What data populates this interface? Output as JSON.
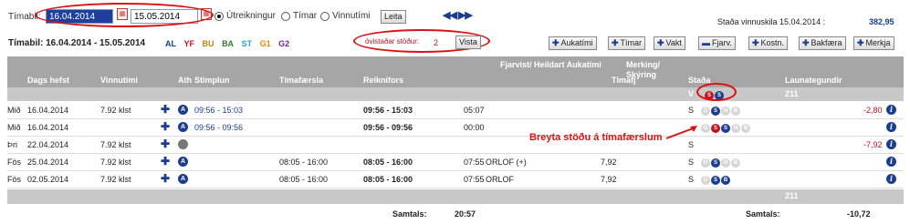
{
  "top": {
    "period_label": "Tímabil:",
    "date_from": "16.04.2014",
    "date_to": "15.05.2014",
    "radio_options": [
      "Útreikningur",
      "Tímar",
      "Vinnutími"
    ],
    "search_button": "Leita",
    "status_label": "Staða vinnuskila 15.04.2014 :",
    "status_value": "382,95"
  },
  "second": {
    "period_text": "Tímabil: 16.04.2014 - 15.05.2014",
    "categories": [
      {
        "label": "AL",
        "color": "#1a3d8f"
      },
      {
        "label": "YF",
        "color": "#c1121f"
      },
      {
        "label": "BU",
        "color": "#b8860b"
      },
      {
        "label": "BA",
        "color": "#2e7d32"
      },
      {
        "label": "ST",
        "color": "#29a3c9"
      },
      {
        "label": "G1",
        "color": "#e08a00"
      },
      {
        "label": "G2",
        "color": "#6a2a8f"
      }
    ],
    "unconfirmed_label": "óvistaðar stöður:",
    "unconfirmed_count": "2",
    "save_button": "Vista",
    "actions": [
      "Aukatími",
      "Tímar",
      "Vakt",
      "Fjarv.",
      "Kostn.",
      "Bakfæra",
      "Merkja"
    ]
  },
  "table": {
    "headers": [
      "",
      "Dags hefst",
      "Vinnutími",
      "Ath",
      "Stimplun",
      "Tímafærsla",
      "Reiknifors",
      "Fjarvist/ Heildart Aukatími",
      "Tímafj",
      "Merking/ Skýring",
      "Staða",
      "Launategundir",
      ""
    ],
    "sub_staða_label": "V",
    "sub_launategundir": "211",
    "rows": [
      {
        "day": "Mið",
        "date": "16.04.2014",
        "vinnutimi": "7.92 klst",
        "icon": "blue",
        "stimplun": "09:56 - 15:03",
        "timafaersla": "",
        "reiknifors": "09:56 - 15:03",
        "heildart": "05:07",
        "aukatimi": "",
        "timafj": "",
        "status": "S",
        "status_icons": [
          "g",
          "b",
          "g",
          "g"
        ],
        "launa": "-2,80"
      },
      {
        "day": "Mið",
        "date": "16.04.2014",
        "vinnutimi": "",
        "icon": "blue",
        "stimplun": "09:56 - 09:56",
        "timafaersla": "",
        "reiknifors": "09:56 - 09:56",
        "heildart": "00:00",
        "aukatimi": "",
        "timafj": "",
        "status": "",
        "status_icons": [
          "g",
          "r",
          "b",
          "g",
          "g"
        ],
        "launa": ""
      },
      {
        "day": "Þri",
        "date": "22.04.2014",
        "vinnutimi": "7.92 klst",
        "icon": "gray",
        "stimplun": "",
        "timafaersla": "",
        "reiknifors": "",
        "heildart": "",
        "aukatimi": "",
        "timafj": "",
        "status": "S",
        "status_icons": [],
        "launa": "-7,92"
      },
      {
        "day": "Fös",
        "date": "25.04.2014",
        "vinnutimi": "7.92 klst",
        "icon": "blue",
        "stimplun": "",
        "timafaersla": "08:05 - 16:00",
        "reiknifors": "08:05 - 16:00",
        "heildart": "07:55",
        "aukatimi": "ORLOF (+)",
        "timafj": "7,92",
        "status": "S",
        "status_icons": [
          "g",
          "b",
          "g",
          "g"
        ],
        "launa": ""
      },
      {
        "day": "Fös",
        "date": "02.05.2014",
        "vinnutimi": "7.92 klst",
        "icon": "blue",
        "stimplun": "",
        "timafaersla": "08:05 - 16:00",
        "reiknifors": "08:05 - 16:00",
        "heildart": "07:55",
        "aukatimi": "ORLOF",
        "timafj": "7,92",
        "status": "S",
        "status_icons": [
          "g",
          "b",
          "b"
        ],
        "launa": ""
      }
    ],
    "footer_launa": "211",
    "totals_label_1": "Samtals:",
    "totals_value_1": "20:57",
    "totals_label_2": "Samtals:",
    "totals_value_2": "-10,72"
  },
  "annotation": "Breyta stöðu á tímafærslum"
}
